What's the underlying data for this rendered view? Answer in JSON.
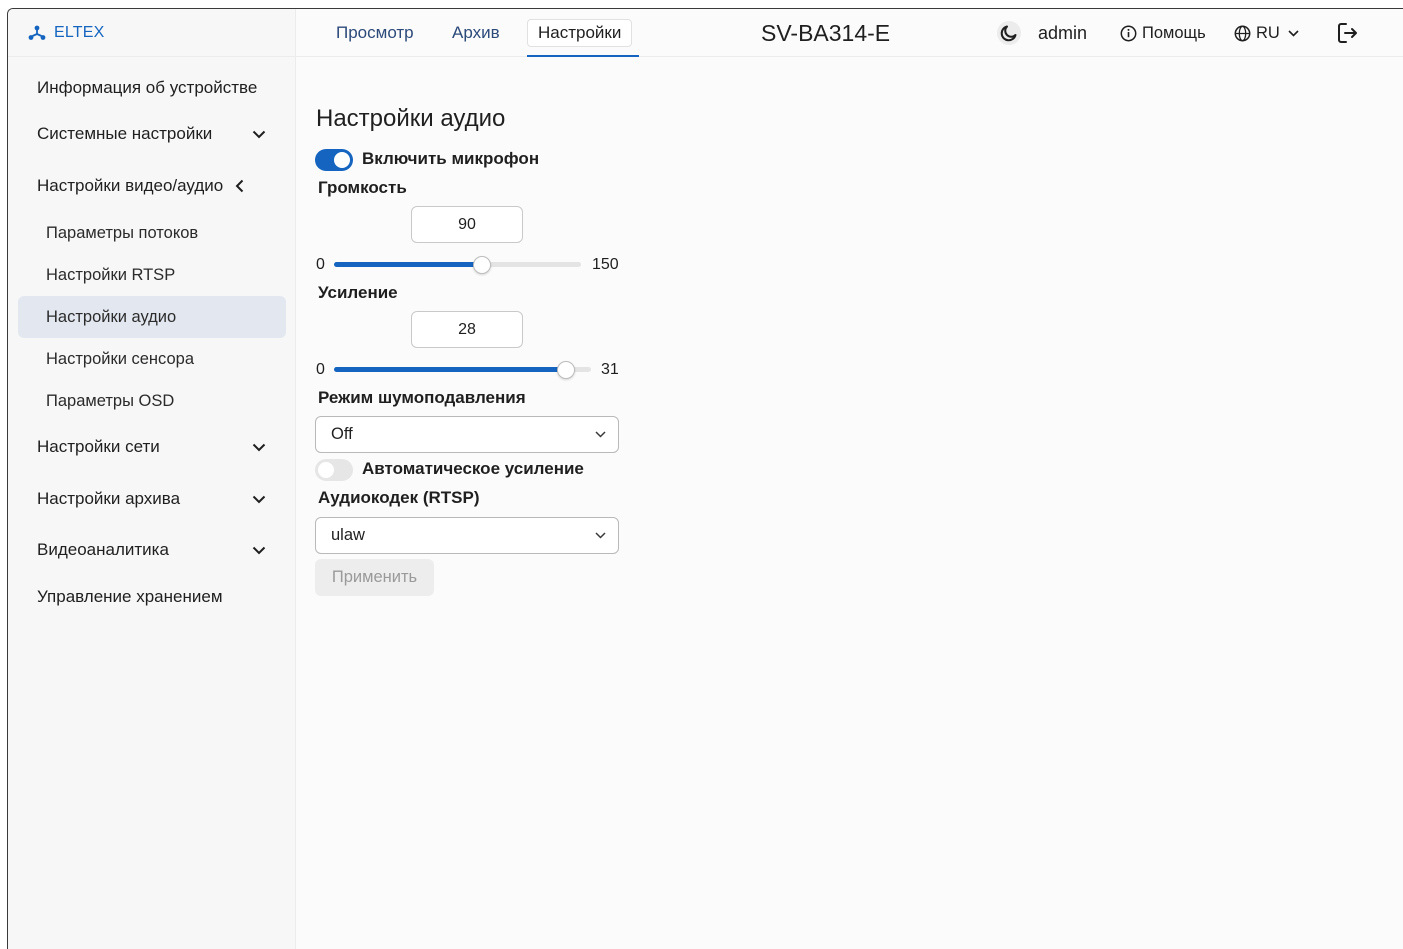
{
  "logo": {
    "text": "ELTEX"
  },
  "header": {
    "tabs": [
      {
        "label": "Просмотр"
      },
      {
        "label": "Архив"
      },
      {
        "label": "Настройки"
      }
    ],
    "device_title": "SV-BA314-E",
    "user": "admin",
    "help_label": "Помощь",
    "language": "RU"
  },
  "sidebar": {
    "items": [
      {
        "label": "Информация об устройстве"
      },
      {
        "label": "Системные настройки"
      },
      {
        "label": "Настройки видео/аудио"
      },
      {
        "label": "Параметры потоков"
      },
      {
        "label": "Настройки RTSP"
      },
      {
        "label": "Настройки аудио"
      },
      {
        "label": "Настройки сенсора"
      },
      {
        "label": "Параметры OSD"
      },
      {
        "label": "Настройки сети"
      },
      {
        "label": "Настройки архива"
      },
      {
        "label": "Видеоаналитика"
      },
      {
        "label": "Управление хранением"
      }
    ]
  },
  "content": {
    "title": "Настройки аудио",
    "mic_toggle": {
      "label": "Включить микрофон",
      "on": true
    },
    "volume": {
      "label": "Громкость",
      "value": "90",
      "min": "0",
      "max": "150",
      "fraction": 0.6
    },
    "gain": {
      "label": "Усиление",
      "value": "28",
      "min": "0",
      "max": "31",
      "fraction": 0.9032
    },
    "noise": {
      "label": "Режим шумоподавления",
      "selected": "Off"
    },
    "agc_toggle": {
      "label": "Автоматическое усиление",
      "on": false
    },
    "codec": {
      "label": "Аудиокодек (RTSP)",
      "selected": "ulaw"
    },
    "apply_label": "Применить"
  },
  "colors": {
    "accent": "#1565c0",
    "active_bg": "#e3e8f0"
  }
}
